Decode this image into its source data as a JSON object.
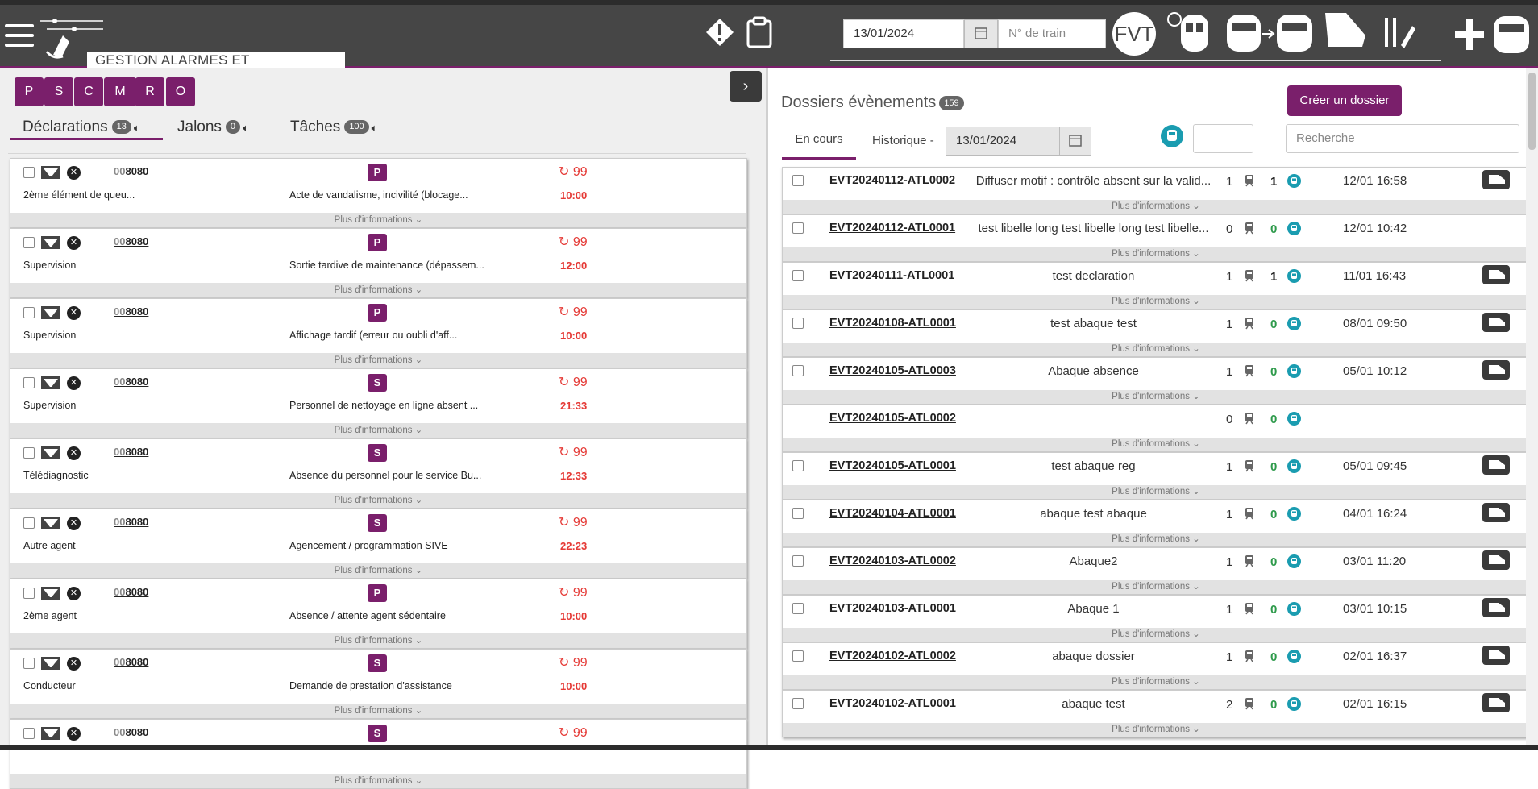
{
  "app": {
    "title": "GESTION ALARMES ET EVENEMENTS"
  },
  "toolbar": {
    "date": "13/01/2024",
    "train_placeholder": "N° de train",
    "fvt_label": "FVT"
  },
  "filters": [
    "P",
    "S",
    "C",
    "M",
    "R",
    "O"
  ],
  "tabs": [
    {
      "label": "Déclarations",
      "count": "13"
    },
    {
      "label": "Jalons",
      "count": "0"
    },
    {
      "label": "Tâches",
      "count": "100"
    }
  ],
  "more_label": "Plus d'informations ⌄",
  "declarations": [
    {
      "train_prefix": "00",
      "train": "8080",
      "letter": "P",
      "count": "99",
      "type": "2ème élément de queu...",
      "desc": "Acte de vandalisme, incivilité (blocage...",
      "time": "10:00"
    },
    {
      "train_prefix": "00",
      "train": "8080",
      "letter": "P",
      "count": "99",
      "type": "Supervision",
      "desc": "Sortie tardive de maintenance (dépassem...",
      "time": "12:00"
    },
    {
      "train_prefix": "00",
      "train": "8080",
      "letter": "P",
      "count": "99",
      "type": "Supervision",
      "desc": "Affichage tardif (erreur ou oubli d'aff...",
      "time": "10:00"
    },
    {
      "train_prefix": "00",
      "train": "8080",
      "letter": "S",
      "count": "99",
      "type": "Supervision",
      "desc": "Personnel de nettoyage en ligne absent ...",
      "time": "21:33"
    },
    {
      "train_prefix": "00",
      "train": "8080",
      "letter": "S",
      "count": "99",
      "type": "Télédiagnostic",
      "desc": "Absence du personnel pour le service Bu...",
      "time": "12:33"
    },
    {
      "train_prefix": "00",
      "train": "8080",
      "letter": "S",
      "count": "99",
      "type": "Autre agent",
      "desc": "Agencement / programmation SIVE",
      "time": "22:23"
    },
    {
      "train_prefix": "00",
      "train": "8080",
      "letter": "P",
      "count": "99",
      "type": "2ème agent",
      "desc": "Absence / attente agent sédentaire",
      "time": "10:00"
    },
    {
      "train_prefix": "00",
      "train": "8080",
      "letter": "S",
      "count": "99",
      "type": "Conducteur",
      "desc": "Demande de prestation d'assistance",
      "time": "10:00"
    },
    {
      "train_prefix": "00",
      "train": "8080",
      "letter": "S",
      "count": "99",
      "type": "",
      "desc": "",
      "time": ""
    }
  ],
  "dossiers": {
    "title": "Dossiers évènements",
    "count": "159",
    "create_label": "Créer un dossier",
    "tab_current": "En cours",
    "tab_history": "Historique -",
    "history_date": "13/01/2024",
    "search_placeholder": "Recherche",
    "rows": [
      {
        "id": "EVT20240112-ATL0002",
        "label": "Diffuser motif : contrôle absent sur la valid...",
        "n1": "1",
        "n2": "1",
        "date": "12/01 16:58",
        "truck": true,
        "checkbox": true
      },
      {
        "id": "EVT20240112-ATL0001",
        "label": "test libelle long test libelle long test libelle...",
        "n1": "0",
        "n2": "0",
        "date": "12/01 10:42",
        "truck": false,
        "checkbox": true
      },
      {
        "id": "EVT20240111-ATL0001",
        "label": "test declaration",
        "n1": "1",
        "n2": "1",
        "date": "11/01 16:43",
        "truck": true,
        "checkbox": true
      },
      {
        "id": "EVT20240108-ATL0001",
        "label": "test abaque test",
        "n1": "1",
        "n2": "0",
        "date": "08/01 09:50",
        "truck": true,
        "checkbox": true
      },
      {
        "id": "EVT20240105-ATL0003",
        "label": "Abaque absence",
        "n1": "1",
        "n2": "0",
        "date": "05/01 10:12",
        "truck": true,
        "checkbox": true
      },
      {
        "id": "EVT20240105-ATL0002",
        "label": "",
        "n1": "0",
        "n2": "0",
        "date": "",
        "truck": false,
        "checkbox": false
      },
      {
        "id": "EVT20240105-ATL0001",
        "label": "test abaque reg",
        "n1": "1",
        "n2": "0",
        "date": "05/01 09:45",
        "truck": true,
        "checkbox": true
      },
      {
        "id": "EVT20240104-ATL0001",
        "label": "abaque test abaque",
        "n1": "1",
        "n2": "0",
        "date": "04/01 16:24",
        "truck": true,
        "checkbox": true
      },
      {
        "id": "EVT20240103-ATL0002",
        "label": "Abaque2",
        "n1": "1",
        "n2": "0",
        "date": "03/01 11:20",
        "truck": true,
        "checkbox": true
      },
      {
        "id": "EVT20240103-ATL0001",
        "label": "Abaque 1",
        "n1": "1",
        "n2": "0",
        "date": "03/01 10:15",
        "truck": true,
        "checkbox": true
      },
      {
        "id": "EVT20240102-ATL0002",
        "label": "abaque dossier",
        "n1": "1",
        "n2": "0",
        "date": "02/01 16:37",
        "truck": true,
        "checkbox": true
      },
      {
        "id": "EVT20240102-ATL0001",
        "label": "abaque test",
        "n1": "2",
        "n2": "0",
        "date": "02/01 16:15",
        "truck": true,
        "checkbox": true
      }
    ]
  },
  "colors": {
    "accent": "#7a1f6b",
    "alert_red": "#e53935",
    "metro_teal": "#1a9cb0",
    "green": "#2e9a4b"
  }
}
